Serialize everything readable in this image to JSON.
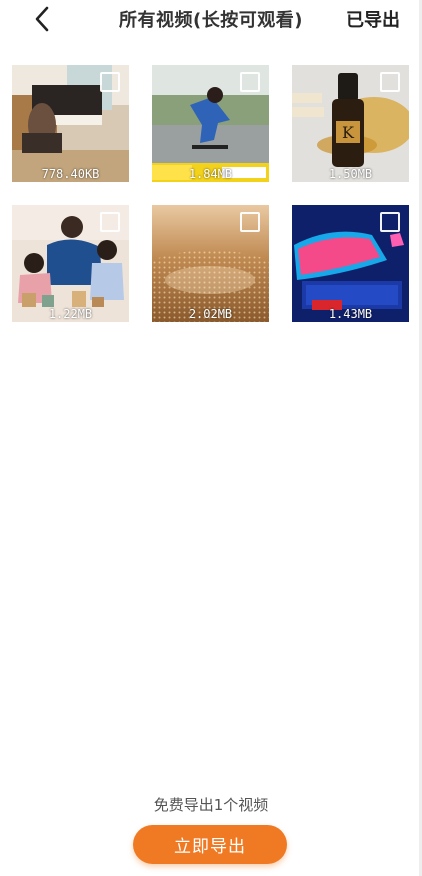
{
  "header": {
    "title": "所有视频(长按可观看)",
    "exported_label": "已导出"
  },
  "videos": [
    {
      "size": "778.40KB",
      "thumb": "piano-room"
    },
    {
      "size": "1.84MB",
      "thumb": "skateboard-girl"
    },
    {
      "size": "1.50MB",
      "thumb": "hair-serum-bottle"
    },
    {
      "size": "1.22MB",
      "thumb": "parent-kids-blocks"
    },
    {
      "size": "2.02MB",
      "thumb": "golden-light-field"
    },
    {
      "size": "1.43MB",
      "thumb": "neon-comedy-stage"
    }
  ],
  "footer": {
    "note": "免费导出1个视频",
    "export_button": "立即导出"
  },
  "colors": {
    "accent": "#f07a24"
  }
}
